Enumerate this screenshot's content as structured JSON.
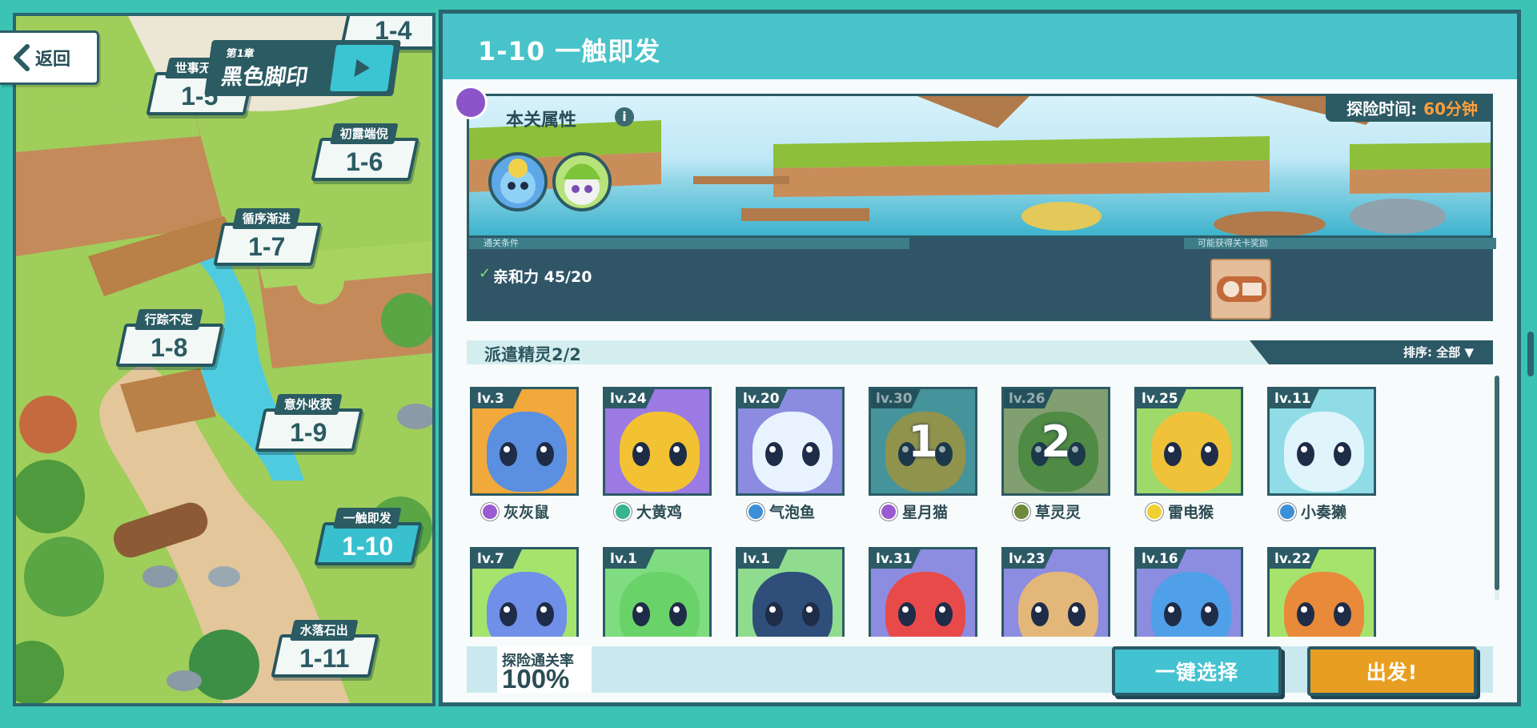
{
  "nav": {
    "back_label": "返回"
  },
  "chapter": {
    "number": "第1章",
    "title": "黑色脚印"
  },
  "map_nodes": [
    {
      "name": "",
      "num": "1-4"
    },
    {
      "name": "世事无常",
      "num": "1-5"
    },
    {
      "name": "初露端倪",
      "num": "1-6"
    },
    {
      "name": "循序渐进",
      "num": "1-7"
    },
    {
      "name": "行踪不定",
      "num": "1-8"
    },
    {
      "name": "意外收获",
      "num": "1-9"
    },
    {
      "name": "一触即发",
      "num": "1-10"
    },
    {
      "name": "水落石出",
      "num": "1-11"
    }
  ],
  "stage": {
    "title": "1-10 一触即发",
    "attributes_label": "本关属性",
    "info_icon": "i",
    "explore_time_label": "探险时间:",
    "explore_time_value": "60分钟",
    "condition_title": "通关条件",
    "condition_check": "✓",
    "condition_text": "亲和力 45/20",
    "reward_title": "可能获得关卡奖励"
  },
  "dispatch": {
    "label": "派遣精灵2/2",
    "sort_label": "排序: 全部 ▼"
  },
  "pets": [
    {
      "level": "lv.3",
      "name": "灰灰鼠",
      "element": "#9b5bd0",
      "bg": "#f0a93a",
      "face": "#5b8fe0",
      "dispatched": ""
    },
    {
      "level": "lv.24",
      "name": "大黄鸡",
      "element": "#37b48f",
      "bg": "#9b7be3",
      "face": "#f2c232",
      "dispatched": ""
    },
    {
      "level": "lv.20",
      "name": "气泡鱼",
      "element": "#3c8fd8",
      "bg": "#8b8be0",
      "face": "#e8f3ff",
      "dispatched": ""
    },
    {
      "level": "lv.30",
      "name": "星月猫",
      "element": "#9b5bd0",
      "bg": "#6bd3d9",
      "face": "#f2d14a",
      "dispatched": "1"
    },
    {
      "level": "lv.26",
      "name": "草灵灵",
      "element": "#6d8a3a",
      "bg": "#d8e88a",
      "face": "#7dc43b",
      "dispatched": "2"
    },
    {
      "level": "lv.25",
      "name": "雷电猴",
      "element": "#f0d030",
      "bg": "#9ed96a",
      "face": "#f0c23a",
      "dispatched": ""
    },
    {
      "level": "lv.11",
      "name": "小奏獭",
      "element": "#3c8fd8",
      "bg": "#8fdce6",
      "face": "#dff4fb",
      "dispatched": ""
    },
    {
      "level": "lv.7",
      "name": "",
      "element": "#9b5bd0",
      "bg": "#a5e36d",
      "face": "#6f8fe8",
      "dispatched": ""
    },
    {
      "level": "lv.1",
      "name": "",
      "element": "#37b48f",
      "bg": "#7fdc80",
      "face": "#69d369",
      "dispatched": ""
    },
    {
      "level": "lv.1",
      "name": "",
      "element": "#3c8fd8",
      "bg": "#8fdc8f",
      "face": "#2f4f7a",
      "dispatched": ""
    },
    {
      "level": "lv.31",
      "name": "",
      "element": "#e05050",
      "bg": "#8c8de0",
      "face": "#e84a4a",
      "dispatched": ""
    },
    {
      "level": "lv.23",
      "name": "",
      "element": "#d88a3a",
      "bg": "#8c8de0",
      "face": "#e3b77a",
      "dispatched": ""
    },
    {
      "level": "lv.16",
      "name": "",
      "element": "#3c8fd8",
      "bg": "#8c8de0",
      "face": "#4fa0e8",
      "dispatched": ""
    },
    {
      "level": "lv.22",
      "name": "",
      "element": "#e05050",
      "bg": "#a5e36d",
      "face": "#e88a3a",
      "dispatched": ""
    }
  ],
  "footer": {
    "rate_label": "探险通关率",
    "rate_value": "100%",
    "auto_select_label": "一键选择",
    "go_label": "出发!"
  },
  "colors": {
    "accent": "#47c3c9",
    "dark": "#2c5a65",
    "go": "#e89f21",
    "time": "#ff9e3a"
  }
}
